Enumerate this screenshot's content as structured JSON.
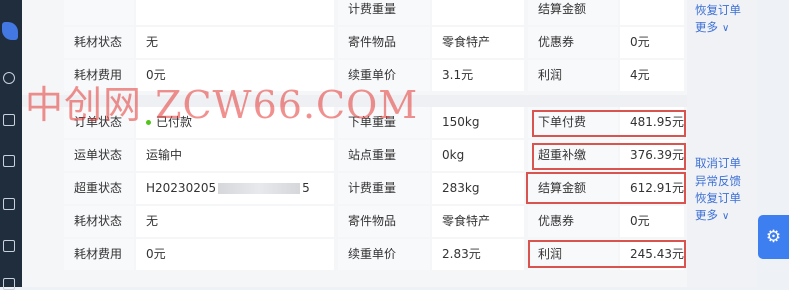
{
  "block1": {
    "rows": [
      {
        "l1": "",
        "v1": "",
        "l2": "计费重量",
        "v2": "",
        "l3": "结算金额",
        "v3": ""
      },
      {
        "l1": "耗材状态",
        "v1": "无",
        "l2": "寄件物品",
        "v2": "零食特产",
        "l3": "优惠券",
        "v3": "0元"
      },
      {
        "l1": "耗材费用",
        "v1": "0元",
        "l2": "续重单价",
        "v2": "3.1元",
        "l3": "利润",
        "v3": "4元"
      }
    ],
    "links": [
      "恢复订单"
    ],
    "more": "更多"
  },
  "block2": {
    "rows": [
      {
        "l1": "订单状态",
        "v1": "已付款",
        "l2": "下单重量",
        "v2": "150kg",
        "l3": "下单付费",
        "v3": "481.95元"
      },
      {
        "l1": "运单状态",
        "v1": "运输中",
        "l2": "站点重量",
        "v2": "0kg",
        "l3": "超重补缴",
        "v3": "376.39元"
      },
      {
        "l1": "超重状态",
        "v1a": "H20230205",
        "v1b": "5",
        "l2": "计费重量",
        "v2": "283kg",
        "l3": "结算金额",
        "v3": "612.91元"
      },
      {
        "l1": "耗材状态",
        "v1": "无",
        "l2": "寄件物品",
        "v2": "零食特产",
        "l3": "优惠券",
        "v3": "0元"
      },
      {
        "l1": "耗材费用",
        "v1": "0元",
        "l2": "续重单价",
        "v2": "2.83元",
        "l3": "利润",
        "v3": "245.43元"
      }
    ],
    "links": [
      "取消订单",
      "异常反馈",
      "恢复订单"
    ],
    "more": "更多"
  },
  "watermark": "中创网 ZCW66.COM",
  "icons": {
    "settings": "gear-icon",
    "chevron": "chevron-down-icon"
  },
  "colors": {
    "highlight": "#d9534f",
    "link": "#3b6fd6",
    "status_dot": "#52c41a",
    "sidebar": "#1f2d3d",
    "gear_button": "#3d7ef0"
  }
}
